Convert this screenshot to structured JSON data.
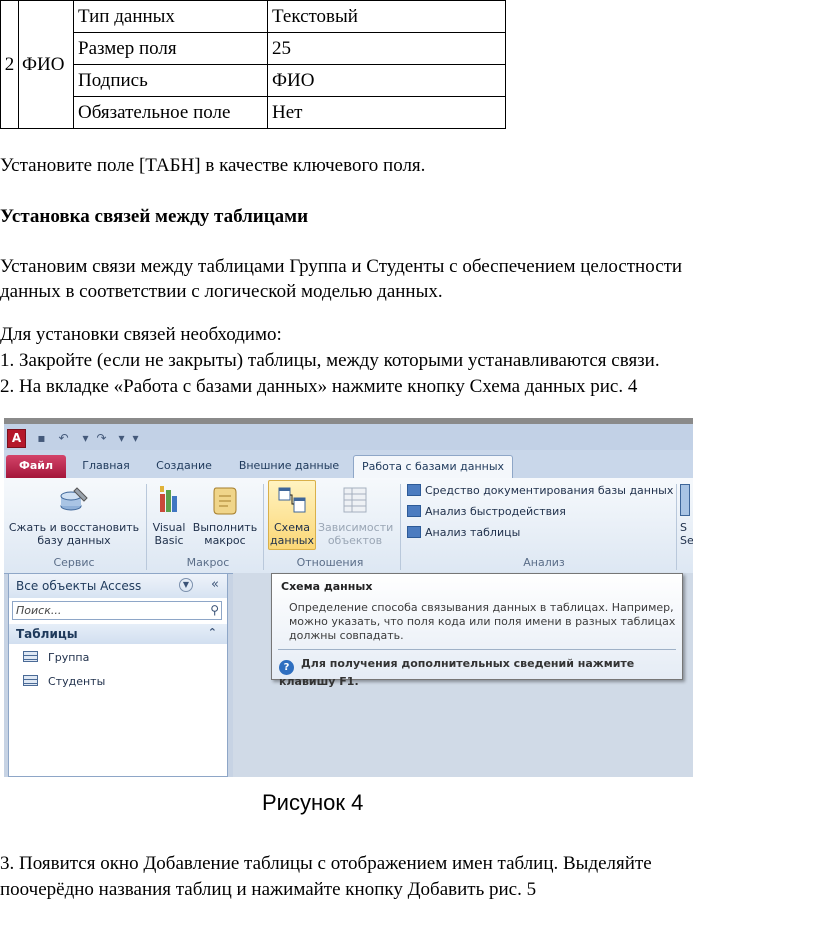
{
  "field_table": {
    "number": "2",
    "field_name": "ФИО",
    "rows": [
      {
        "property": "Тип данных",
        "value": "Текстовый"
      },
      {
        "property": "Размер поля",
        "value": "25"
      },
      {
        "property": "Подпись",
        "value": "ФИО"
      },
      {
        "property": "Обязательное поле",
        "value": "Нет"
      }
    ]
  },
  "text": {
    "key_field": "Установите поле [ТАБН] в качестве ключевого поля.",
    "heading": "Установка связей между таблицами",
    "intro_line1": "Установим связи между таблицами Группа и Студенты с обеспечением целостности",
    "intro_line2": "данных в соответствии с логической моделью данных.",
    "steps_intro": "Для установки связей необходимо:",
    "step1": "1. Закройте (если не закрыты) таблицы, между которыми устанавливаются связи.",
    "step2": "2. На вкладке «Работа с базами данных» нажмите кнопку Схема данных рис. 4",
    "step3_line1": "3. Появится окно Добавление таблицы с отображением имен таблиц. Выделяйте",
    "step3_line2": "поочерёдно названия таблиц и нажимайте кнопку Добавить рис. 5"
  },
  "figure_caption": "Рисунок 4",
  "access": {
    "app_letter": "A",
    "tabs": {
      "file": "Файл",
      "home": "Главная",
      "create": "Создание",
      "external": "Внешние данные",
      "database_tools": "Работа с базами данных"
    },
    "ribbon": {
      "compact_line1": "Сжать и восстановить",
      "compact_line2": "базу данных",
      "vb_line1": "Visual",
      "vb_line2": "Basic",
      "run_line1": "Выполнить",
      "run_line2": "макрос",
      "rel_line1": "Схема",
      "rel_line2": "данных",
      "dep_line1": "Зависимости",
      "dep_line2": "объектов",
      "documenter": "Средство документирования базы данных",
      "performance": "Анализ быстродействия",
      "analyze_table": "Анализ таблицы",
      "cut_line1": "S",
      "cut_line2": "Se",
      "groups": {
        "service": "Сервис",
        "macro": "Макрос",
        "relationships": "Отношения",
        "analysis": "Анализ"
      }
    },
    "nav": {
      "header": "Все объекты Access",
      "search_placeholder": "Поиск...",
      "group": "Таблицы",
      "items": [
        "Группа",
        "Студенты"
      ]
    },
    "tooltip": {
      "title": "Схема данных",
      "body_line1": "Определение способа связывания данных в таблицах. Например,",
      "body_line2": "можно указать, что поля кода или поля имени в разных таблицах",
      "body_line3": "должны совпадать.",
      "help": "Для получения дополнительных сведений нажмите клавишу F1."
    },
    "colors": {
      "file_tab": "#b5183f",
      "highlight": "#fbd776",
      "ribbon_bg": "#e8eef7"
    }
  }
}
